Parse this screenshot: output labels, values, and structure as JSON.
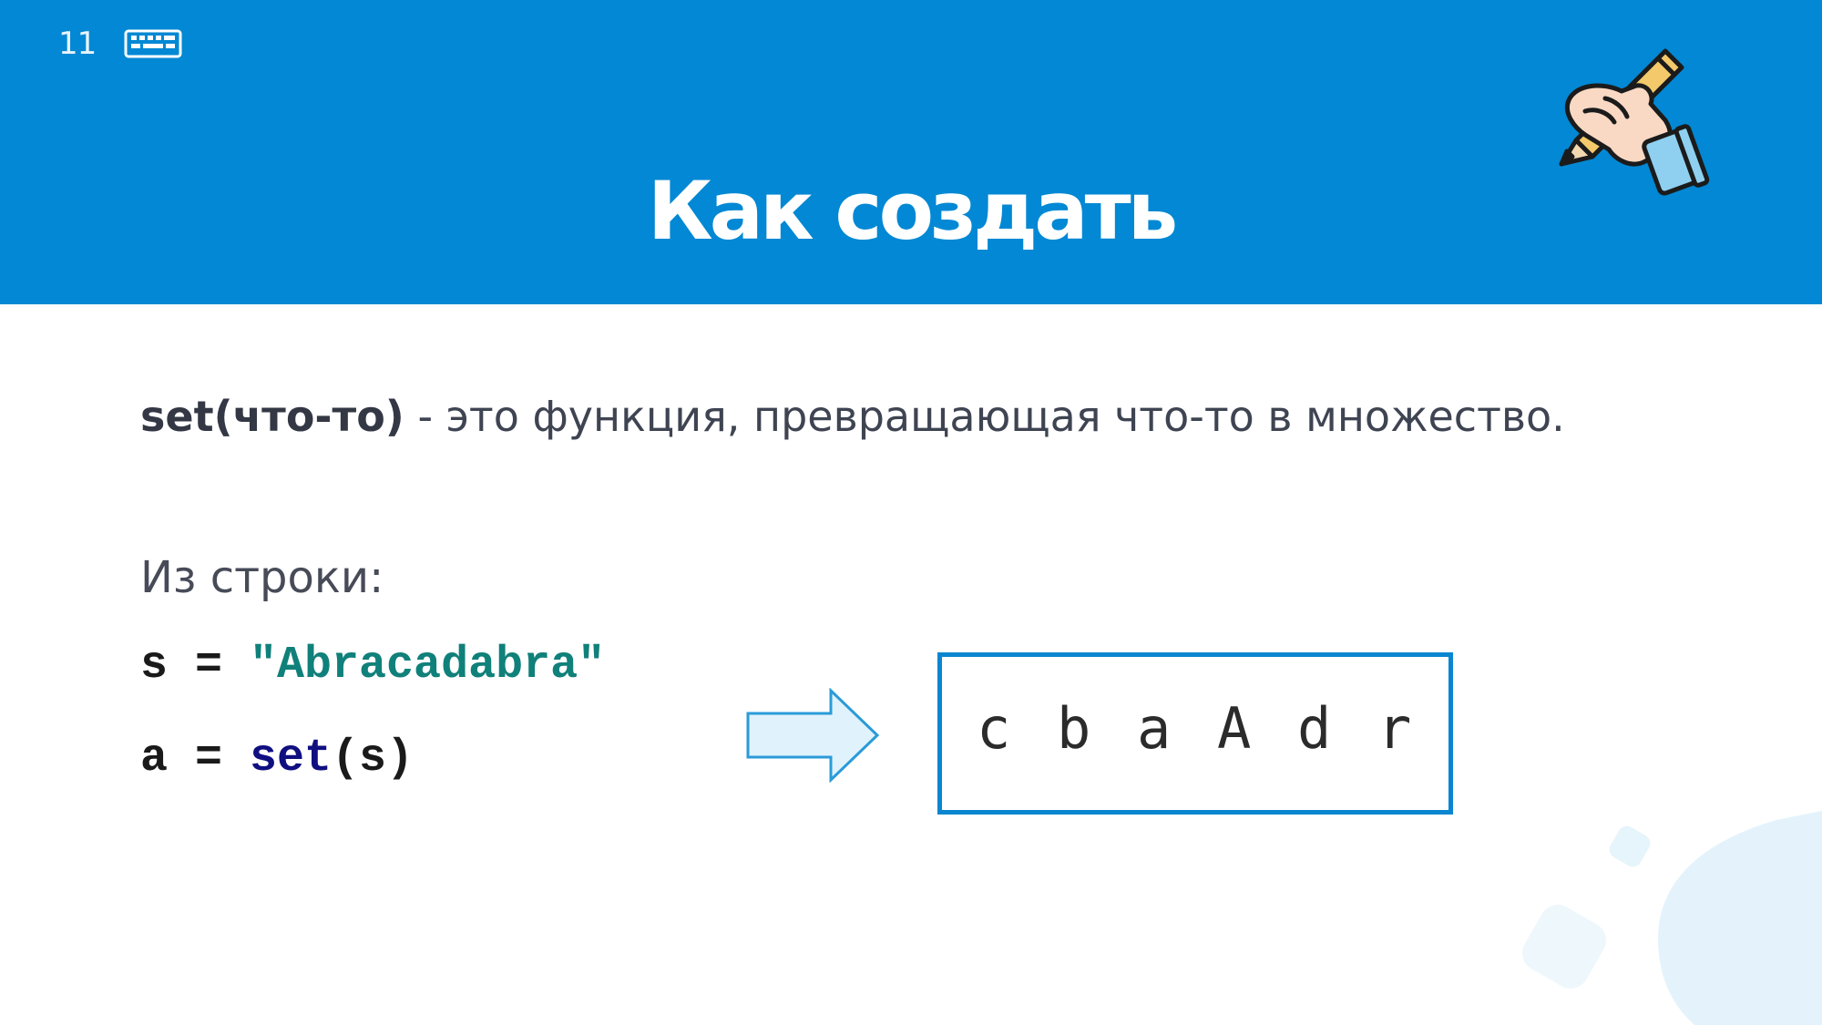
{
  "slide": {
    "number": "11",
    "title": "Как создать"
  },
  "definition": {
    "term": "set(что-то)",
    "text": " - это функция, превращающая что-то в множество."
  },
  "from_string_label": "Из строки:",
  "code": {
    "line1": {
      "var": "s",
      "op": " = ",
      "string": "\"Abracadabra\""
    },
    "line2": {
      "var": "a",
      "op": " = ",
      "func": "set",
      "args": "(s)"
    }
  },
  "output": {
    "chars": [
      "c",
      "b",
      "a",
      "A",
      "d",
      "r"
    ]
  },
  "icons": {
    "keyboard": "keyboard-icon",
    "hand_pencil": "hand-writing-icon",
    "arrow": "arrow-right-icon"
  },
  "colors": {
    "header_bg": "#0288d4",
    "output_border": "#0a86d0",
    "string_color": "#10807a",
    "builtin_color": "#0f0f80"
  }
}
